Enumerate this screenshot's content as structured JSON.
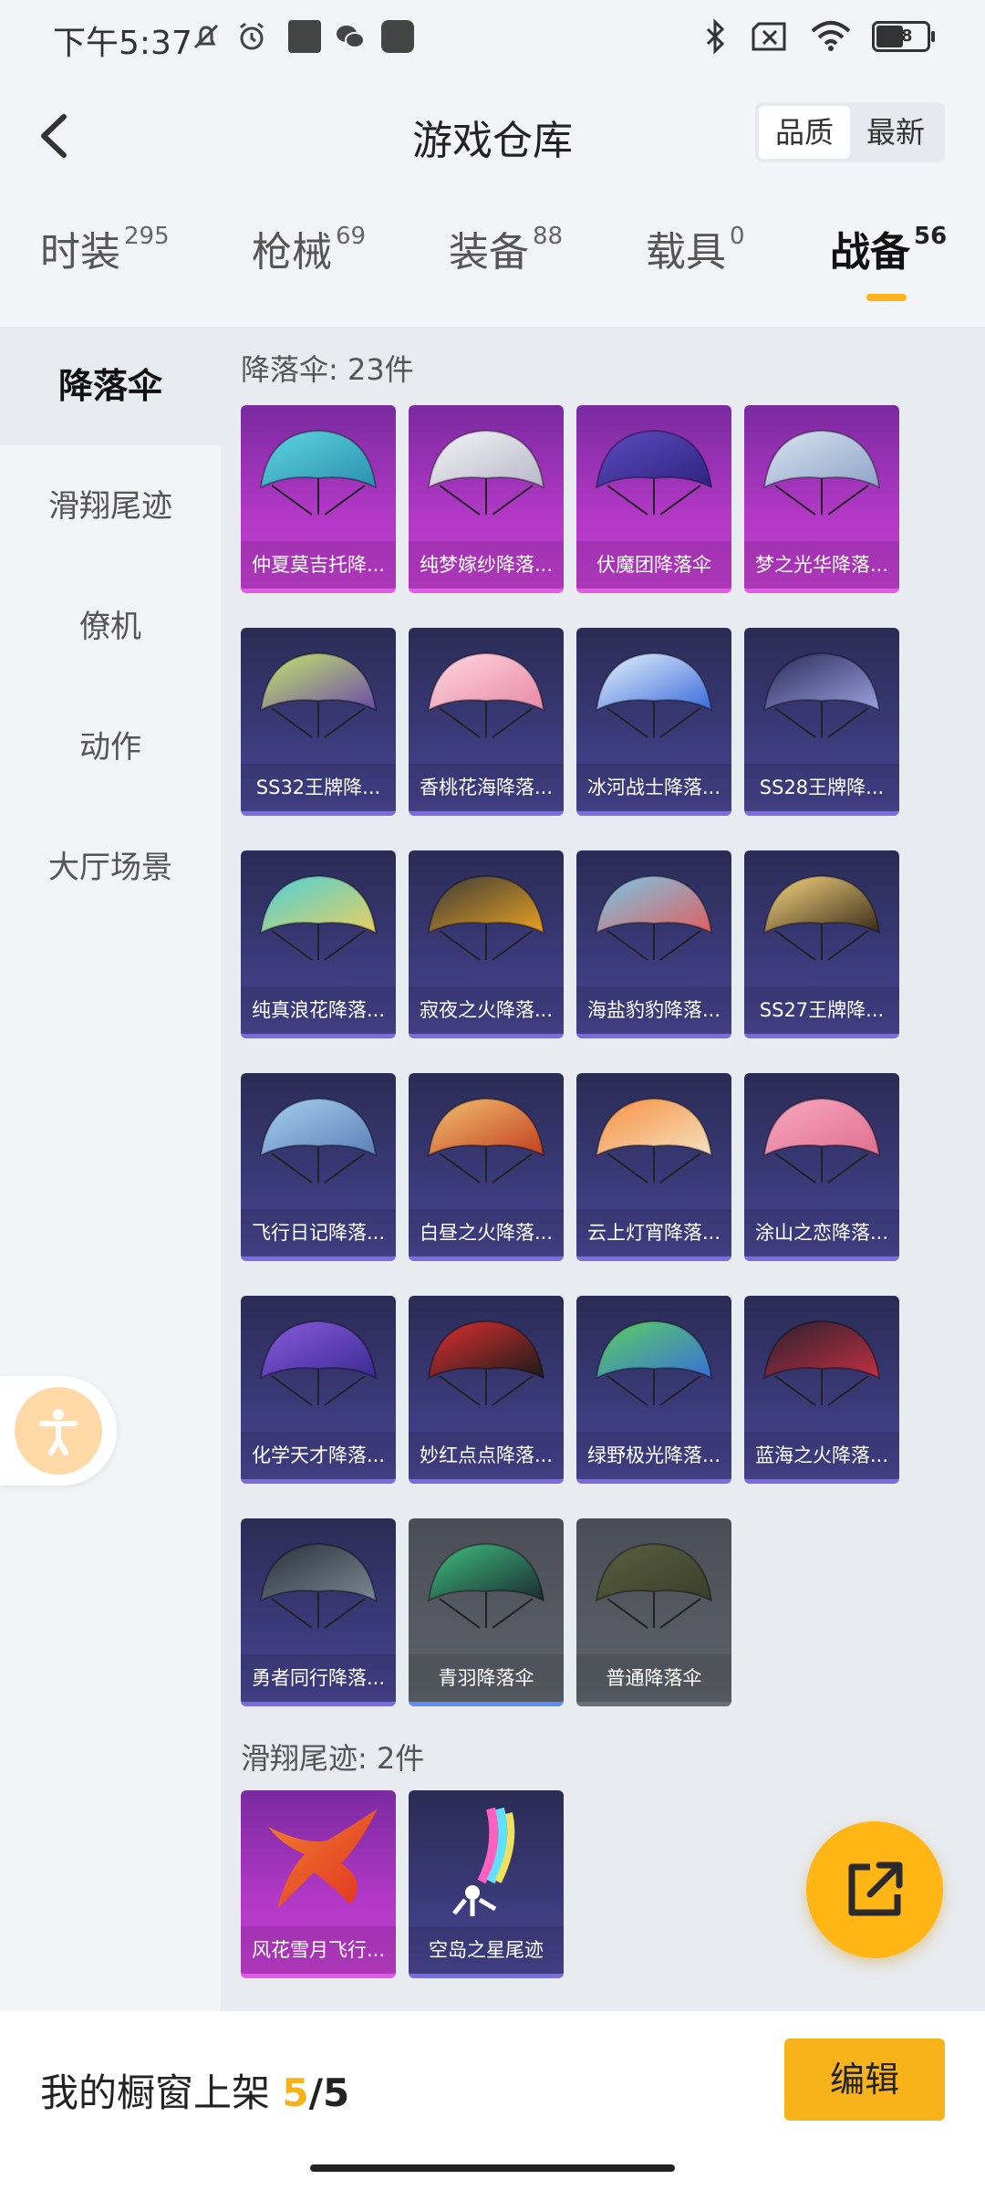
{
  "status_bar": {
    "time": "下午5:37",
    "battery": "58"
  },
  "header": {
    "title": "游戏仓库",
    "sort_options": [
      "品质",
      "最新"
    ],
    "active_sort": "品质"
  },
  "categories": [
    {
      "label": "时装",
      "count": "295"
    },
    {
      "label": "枪械",
      "count": "69"
    },
    {
      "label": "装备",
      "count": "88"
    },
    {
      "label": "载具",
      "count": "0"
    },
    {
      "label": "战备",
      "count": "56",
      "active": true
    }
  ],
  "sidebar": {
    "items": [
      {
        "label": "降落伞",
        "active": true
      },
      {
        "label": "滑翔尾迹"
      },
      {
        "label": "僚机"
      },
      {
        "label": "动作"
      },
      {
        "label": "大厅场景"
      }
    ]
  },
  "sections": [
    {
      "title": "降落伞: 23件",
      "items": [
        {
          "name": "仲夏莫吉托降...",
          "rarity": "purple",
          "art": "teal"
        },
        {
          "name": "纯梦嫁纱降落...",
          "rarity": "purple",
          "art": "white"
        },
        {
          "name": "伏魔团降落伞",
          "rarity": "purple",
          "art": "violet"
        },
        {
          "name": "梦之光华降落...",
          "rarity": "purple",
          "art": "silver"
        },
        {
          "name": "SS32王牌降...",
          "rarity": "blue",
          "art": "lime"
        },
        {
          "name": "香桃花海降落...",
          "rarity": "blue",
          "art": "pink"
        },
        {
          "name": "冰河战士降落...",
          "rarity": "blue",
          "art": "ice"
        },
        {
          "name": "SS28王牌降...",
          "rarity": "blue",
          "art": "navy"
        },
        {
          "name": "纯真浪花降落...",
          "rarity": "blue",
          "art": "aqua"
        },
        {
          "name": "寂夜之火降落...",
          "rarity": "blue",
          "art": "dark"
        },
        {
          "name": "海盐豹豹降落...",
          "rarity": "blue",
          "art": "stripe"
        },
        {
          "name": "SS27王牌降...",
          "rarity": "blue",
          "art": "gold"
        },
        {
          "name": "飞行日记降落...",
          "rarity": "blue",
          "art": "sky"
        },
        {
          "name": "白昼之火降落...",
          "rarity": "blue",
          "art": "ember"
        },
        {
          "name": "云上灯宵降落...",
          "rarity": "blue",
          "art": "orange"
        },
        {
          "name": "涂山之恋降落...",
          "rarity": "blue",
          "art": "rose"
        },
        {
          "name": "化学天才降落...",
          "rarity": "blue",
          "art": "purple"
        },
        {
          "name": "妙红点点降落...",
          "rarity": "blue",
          "art": "ladybug"
        },
        {
          "name": "绿野极光降落...",
          "rarity": "blue",
          "art": "green"
        },
        {
          "name": "蓝海之火降落...",
          "rarity": "blue",
          "art": "darkred"
        },
        {
          "name": "勇者同行降落...",
          "rarity": "blue",
          "art": "black"
        },
        {
          "name": "青羽降落伞",
          "rarity": "grey",
          "art": "jade"
        },
        {
          "name": "普通降落伞",
          "rarity": "grey2",
          "art": "olive"
        }
      ]
    },
    {
      "title": "滑翔尾迹: 2件",
      "items": [
        {
          "name": "风花雪月飞行...",
          "rarity": "purple",
          "art": "phoenix"
        },
        {
          "name": "空岛之星尾迹",
          "rarity": "blue",
          "art": "rainbow"
        }
      ]
    }
  ],
  "footer": {
    "showcase_label": "我的橱窗上架",
    "showcase_count": "5",
    "showcase_sep": "/",
    "showcase_total": "5",
    "edit_label": "编辑"
  },
  "colors": {
    "accent": "#f8b21a",
    "purple_rarity": "#b238c6",
    "blue_rarity": "#3b3a7a",
    "grey_rarity": "#5f636b"
  },
  "icons": [
    "mute-icon",
    "alarm-icon",
    "wechat-icon",
    "bluetooth-icon",
    "sim-off-icon",
    "wifi-icon",
    "battery-icon",
    "back-icon",
    "accessibility-icon",
    "share-icon"
  ]
}
